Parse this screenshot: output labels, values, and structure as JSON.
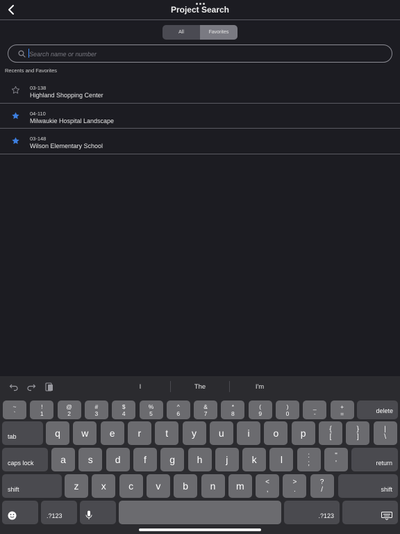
{
  "header": {
    "title": "Project Search",
    "back_icon": "chevron-left-icon",
    "grabber_icon": "more-dots-icon"
  },
  "segmented": {
    "options": [
      "All",
      "Favorites"
    ],
    "selected": "Favorites"
  },
  "search": {
    "placeholder": "Search name or number",
    "value": "",
    "icon": "search-icon"
  },
  "section_label": "Recents and Favorites",
  "projects": [
    {
      "number": "03-138",
      "name": "Highland Shopping Center",
      "favorite": false
    },
    {
      "number": "04-110",
      "name": "Milwaukie Hospital Landscape",
      "favorite": true
    },
    {
      "number": "03-148",
      "name": "Wilson Elementary School",
      "favorite": true
    }
  ],
  "colors": {
    "accent": "#3d7fe0",
    "background": "#1c1c22",
    "keyboard": "#2b2b2f",
    "key": "#6b6b6f",
    "key_dark": "#4a4a4f"
  },
  "keyboard": {
    "suggestions": [
      "I",
      "The",
      "I'm"
    ],
    "tools": [
      "undo-icon",
      "redo-icon",
      "paste-icon"
    ],
    "number_row": [
      {
        "top": "~",
        "bottom": "`"
      },
      {
        "top": "!",
        "bottom": "1"
      },
      {
        "top": "@",
        "bottom": "2"
      },
      {
        "top": "#",
        "bottom": "3"
      },
      {
        "top": "$",
        "bottom": "4"
      },
      {
        "top": "%",
        "bottom": "5"
      },
      {
        "top": "^",
        "bottom": "6"
      },
      {
        "top": "&",
        "bottom": "7"
      },
      {
        "top": "*",
        "bottom": "8"
      },
      {
        "top": "(",
        "bottom": "9"
      },
      {
        "top": ")",
        "bottom": "0"
      },
      {
        "top": "_",
        "bottom": "-"
      },
      {
        "top": "+",
        "bottom": "="
      }
    ],
    "delete_label": "delete",
    "tab_label": "tab",
    "row_q": [
      "q",
      "w",
      "e",
      "r",
      "t",
      "y",
      "u",
      "i",
      "o",
      "p"
    ],
    "row_q_extra": [
      {
        "top": "{",
        "bottom": "["
      },
      {
        "top": "}",
        "bottom": "]"
      },
      {
        "top": "|",
        "bottom": "\\"
      }
    ],
    "caps_label": "caps lock",
    "row_a": [
      "a",
      "s",
      "d",
      "f",
      "g",
      "h",
      "j",
      "k",
      "l"
    ],
    "row_a_extra": [
      {
        "top": ":",
        "bottom": ";"
      },
      {
        "top": "\"",
        "bottom": "'"
      }
    ],
    "return_label": "return",
    "shift_label": "shift",
    "row_z": [
      "z",
      "x",
      "c",
      "v",
      "b",
      "n",
      "m"
    ],
    "row_z_extra": [
      {
        "top": "<",
        "bottom": ","
      },
      {
        "top": ">",
        "bottom": "."
      },
      {
        "top": "?",
        "bottom": "/"
      }
    ],
    "mode_label": ".?123",
    "emoji_icon": "emoji-icon",
    "mic_icon": "microphone-icon",
    "dismiss_icon": "keyboard-dismiss-icon"
  }
}
